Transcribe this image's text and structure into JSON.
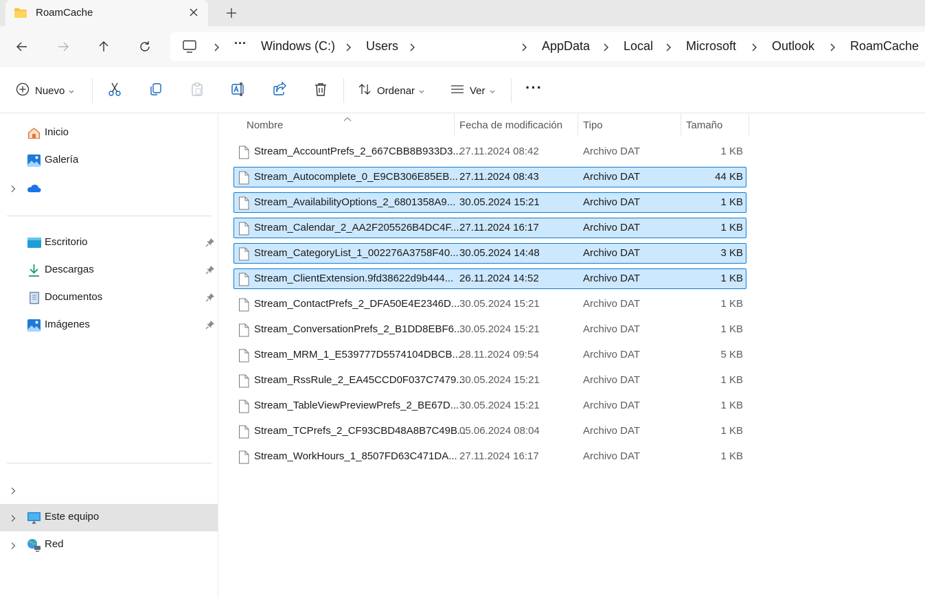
{
  "tab": {
    "title": "RoamCache"
  },
  "breadcrumb": {
    "more": "···",
    "items": [
      "Windows (C:)",
      "Users",
      "AppData",
      "Local",
      "Microsoft",
      "Outlook",
      "RoamCache"
    ]
  },
  "toolbar": {
    "new_label": "Nuevo",
    "sort_label": "Ordenar",
    "view_label": "Ver",
    "more_label": "···"
  },
  "sidebar": {
    "quick": [
      {
        "label": "Inicio",
        "icon": "home-icon"
      },
      {
        "label": "Galería",
        "icon": "gallery-icon"
      },
      {
        "label": "",
        "icon": "onedrive-cloud-icon"
      }
    ],
    "pinned": [
      {
        "label": "Escritorio",
        "icon": "desktop-folder-icon"
      },
      {
        "label": "Descargas",
        "icon": "downloads-icon"
      },
      {
        "label": "Documentos",
        "icon": "documents-icon"
      },
      {
        "label": "Imágenes",
        "icon": "pictures-icon"
      }
    ],
    "bottom": [
      {
        "label": "",
        "icon": ""
      },
      {
        "label": "Este equipo",
        "icon": "this-pc-icon"
      },
      {
        "label": "Red",
        "icon": "network-icon"
      }
    ]
  },
  "columns": {
    "name": "Nombre",
    "date": "Fecha de modificación",
    "type": "Tipo",
    "size": "Tamaño"
  },
  "files": [
    {
      "name": "Stream_AccountPrefs_2_667CBB8B933D3...",
      "date": "27.11.2024 08:42",
      "type": "Archivo DAT",
      "size": "1 KB",
      "selected": false
    },
    {
      "name": "Stream_Autocomplete_0_E9CB306E85EB...",
      "date": "27.11.2024 08:43",
      "type": "Archivo DAT",
      "size": "44 KB",
      "selected": true
    },
    {
      "name": "Stream_AvailabilityOptions_2_6801358A9...",
      "date": "30.05.2024 15:21",
      "type": "Archivo DAT",
      "size": "1 KB",
      "selected": true
    },
    {
      "name": "Stream_Calendar_2_AA2F205526B4DC4F...",
      "date": "27.11.2024 16:17",
      "type": "Archivo DAT",
      "size": "1 KB",
      "selected": true
    },
    {
      "name": "Stream_CategoryList_1_002276A3758F40...",
      "date": "30.05.2024 14:48",
      "type": "Archivo DAT",
      "size": "3 KB",
      "selected": true
    },
    {
      "name": "Stream_ClientExtension.9fd38622d9b444...",
      "date": "26.11.2024 14:52",
      "type": "Archivo DAT",
      "size": "1 KB",
      "selected": true
    },
    {
      "name": "Stream_ContactPrefs_2_DFA50E4E2346D...",
      "date": "30.05.2024 15:21",
      "type": "Archivo DAT",
      "size": "1 KB",
      "selected": false
    },
    {
      "name": "Stream_ConversationPrefs_2_B1DD8EBF6...",
      "date": "30.05.2024 15:21",
      "type": "Archivo DAT",
      "size": "1 KB",
      "selected": false
    },
    {
      "name": "Stream_MRM_1_E539777D5574104DBCB...",
      "date": "28.11.2024 09:54",
      "type": "Archivo DAT",
      "size": "5 KB",
      "selected": false
    },
    {
      "name": "Stream_RssRule_2_EA45CCD0F037C7479...",
      "date": "30.05.2024 15:21",
      "type": "Archivo DAT",
      "size": "1 KB",
      "selected": false
    },
    {
      "name": "Stream_TableViewPreviewPrefs_2_BE67D...",
      "date": "30.05.2024 15:21",
      "type": "Archivo DAT",
      "size": "1 KB",
      "selected": false
    },
    {
      "name": "Stream_TCPrefs_2_CF93CBD48A8B7C49B...",
      "date": "05.06.2024 08:04",
      "type": "Archivo DAT",
      "size": "1 KB",
      "selected": false
    },
    {
      "name": "Stream_WorkHours_1_8507FD63C471DA...",
      "date": "27.11.2024 16:17",
      "type": "Archivo DAT",
      "size": "1 KB",
      "selected": false
    }
  ],
  "colors": {
    "selection_bg": "#cce8ff",
    "selection_border": "#0f7bd3",
    "accent": "#0f6cbd"
  }
}
